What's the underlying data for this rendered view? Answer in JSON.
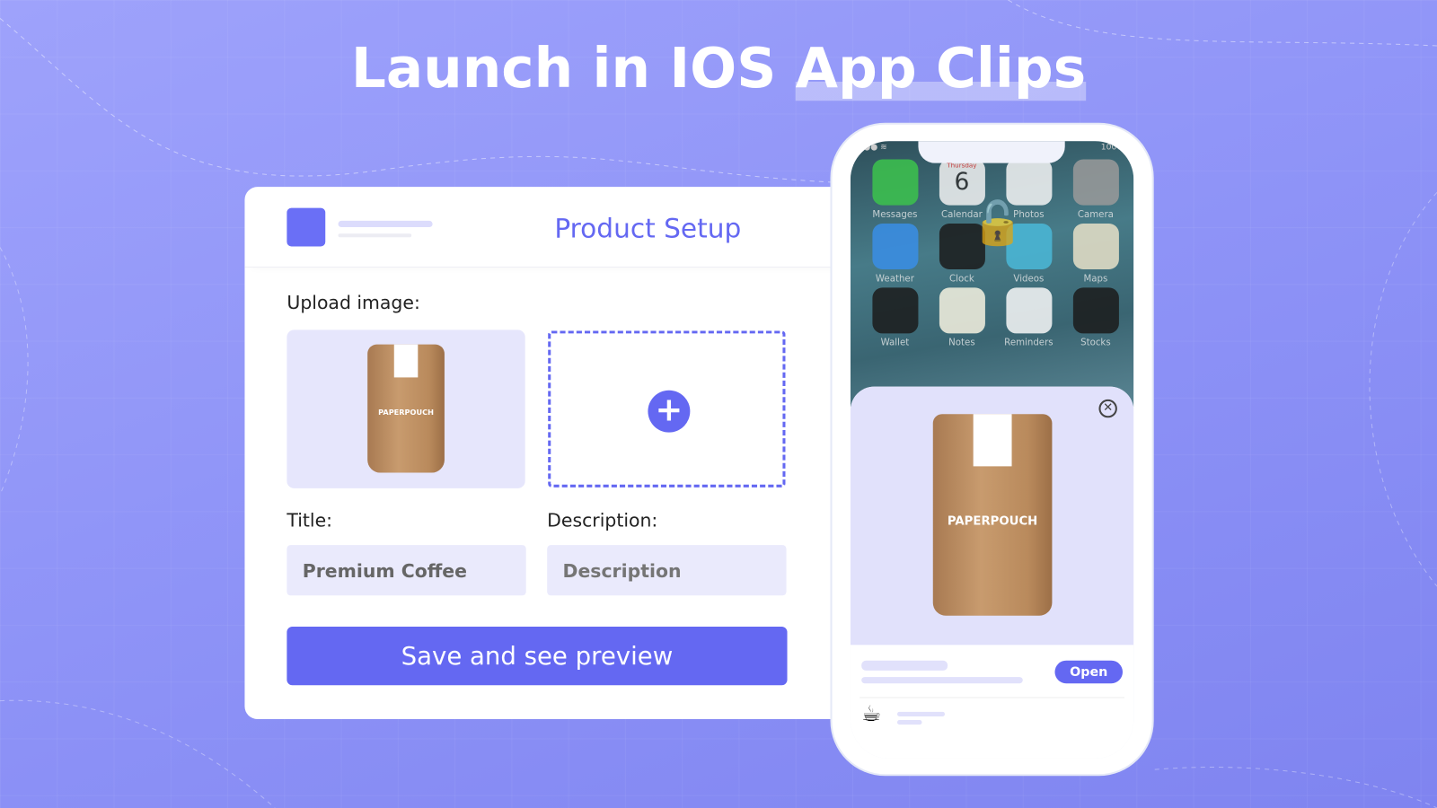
{
  "headline": {
    "part1": "Launch in IOS ",
    "part2": "App Clips"
  },
  "form": {
    "title": "Product Setup",
    "upload_label": "Upload image:",
    "title_label": "Title:",
    "title_value": "Premium Coffee",
    "description_label": "Description:",
    "description_placeholder": "Description",
    "save_label": "Save and see preview",
    "product_brand": "PAPERPOUCH"
  },
  "phone": {
    "status_battery": "100%",
    "apps": [
      {
        "name": "Messages",
        "color": "#3cc34c"
      },
      {
        "name": "Calendar",
        "color": "#f2f2f2"
      },
      {
        "name": "Photos",
        "color": "#f4f4f4"
      },
      {
        "name": "Camera",
        "color": "#9a9a9a"
      },
      {
        "name": "Weather",
        "color": "#3a8ee6"
      },
      {
        "name": "Clock",
        "color": "#1b1b1b"
      },
      {
        "name": "Videos",
        "color": "#4ab8d8"
      },
      {
        "name": "Maps",
        "color": "#e8e0c8"
      },
      {
        "name": "Wallet",
        "color": "#1b1b1b"
      },
      {
        "name": "Notes",
        "color": "#f6f2e0"
      },
      {
        "name": "Reminders",
        "color": "#f8f8f8"
      },
      {
        "name": "Stocks",
        "color": "#1b1b1b"
      }
    ],
    "calendar_day": "Thursday",
    "calendar_date": "6",
    "open_label": "Open",
    "accent": "#6468f2"
  }
}
